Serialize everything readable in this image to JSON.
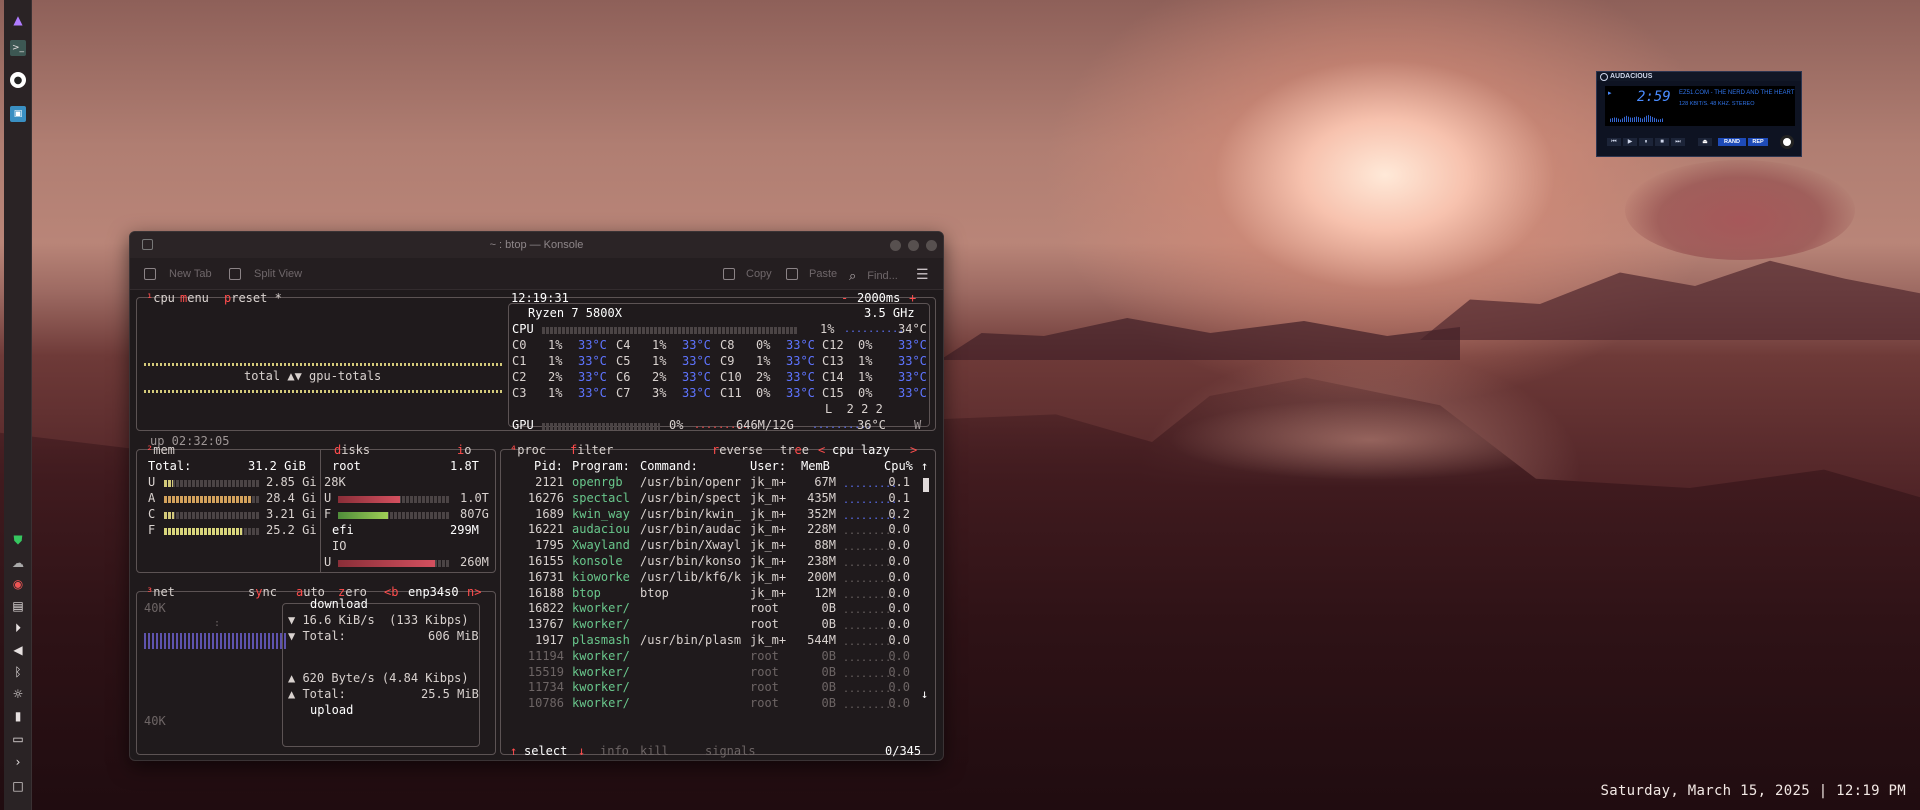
{
  "desktop": {
    "clock": "Saturday, March 15, 2025 | 12:19 PM"
  },
  "audacious": {
    "title": "AUDACIOUS",
    "time": "2:59",
    "track": "EZ51.COM - THE NERD AND THE HEART",
    "info": "128 KBIT/S. 48 KHZ. STEREO",
    "shuffle_label": "RAND",
    "repeat_label": "REP",
    "controls": [
      "prev",
      "play",
      "pause",
      "stop",
      "next"
    ]
  },
  "konsole": {
    "title": "~ : btop — Konsole",
    "toolbar": {
      "new_tab": "New Tab",
      "split_view": "Split View",
      "copy": "Copy",
      "paste": "Paste",
      "find": "Find..."
    }
  },
  "btop": {
    "cpu_header": {
      "cpu": "cpu",
      "menu": "menu",
      "preset": "preset *",
      "clock": "12:19:31",
      "interval": "2000ms",
      "minus": "-",
      "plus": "+"
    },
    "graph_label": "total ▲▼ gpu-totals",
    "uptime": "up 02:32:05",
    "cpu_model": "Ryzen 7 5800X",
    "cpu_freq": "3.5 GHz",
    "cpu_total": {
      "label": "CPU",
      "pct": "1%",
      "temp": "34°C",
      "usage": 0.01
    },
    "cores": [
      [
        "C0",
        "1%",
        "33°C",
        "C4",
        "1%",
        "33°C",
        "C8",
        "0%",
        "33°C",
        "C12",
        "0%",
        "33°C"
      ],
      [
        "C1",
        "1%",
        "33°C",
        "C5",
        "1%",
        "33°C",
        "C9",
        "1%",
        "33°C",
        "C13",
        "1%",
        "33°C"
      ],
      [
        "C2",
        "2%",
        "33°C",
        "C6",
        "2%",
        "33°C",
        "C10",
        "2%",
        "33°C",
        "C14",
        "1%",
        "33°C"
      ],
      [
        "C3",
        "1%",
        "33°C",
        "C7",
        "3%",
        "33°C",
        "C11",
        "0%",
        "33°C",
        "C15",
        "0%",
        "33°C"
      ]
    ],
    "load": "L  2 2 2",
    "gpu": {
      "label": "GPU",
      "pct": "0%",
      "mem": "646M/12G",
      "temp": "36°C",
      "w": "W",
      "usage": 0.0
    },
    "mem": {
      "title": "mem",
      "total_label": "Total:",
      "total": "31.2 GiB",
      "rows": [
        {
          "key": "U",
          "value": "2.85 Gi",
          "fraction": 0.09,
          "color": "#d3c97a"
        },
        {
          "key": "A",
          "value": "28.4 Gi",
          "fraction": 0.91,
          "color": "#d3a25c"
        },
        {
          "key": "C",
          "value": "3.21 Gi",
          "fraction": 0.1,
          "color": "#d3c97a"
        },
        {
          "key": "F",
          "value": "25.2 Gi",
          "fraction": 0.81,
          "color": "#d9d67c"
        }
      ]
    },
    "disks": {
      "title": "disks",
      "io": "io",
      "root": {
        "name": "root",
        "size": "1.8T",
        "io": "28K",
        "used_label": "U",
        "used": "1.0T",
        "used_frac": 0.55,
        "free_label": "F",
        "free": "807G",
        "free_frac": 0.45
      },
      "efi": {
        "name": "efi",
        "size": "299M",
        "io": "IO",
        "used_label": "U",
        "used": "260M",
        "used_frac": 0.87
      }
    },
    "net": {
      "title": "net",
      "sync": "sync",
      "auto": "auto",
      "zero": "zero",
      "iface_prev": "<b",
      "iface": "enp34s0",
      "iface_next": "n>",
      "scale_top": "40K",
      "scale_bottom": "40K",
      "download": "download",
      "dl_rate": "16.6 KiB/s  (133 Kibps)",
      "dl_total_label": "Total:",
      "dl_total": "606 MiB",
      "ul_rate": "620 Byte/s (4.84 Kibps)",
      "ul_total_label": "Total:",
      "ul_total": "25.5 MiB",
      "upload": "upload"
    },
    "proc": {
      "title": "proc",
      "filter": "filter",
      "reverse": "reverse",
      "tree": "tree",
      "sort": "cpu lazy",
      "headers": {
        "pid": "Pid:",
        "program": "Program:",
        "command": "Command:",
        "user": "User:",
        "mem": "MemB",
        "cpu": "Cpu%"
      },
      "rows": [
        {
          "pid": "2121",
          "program": "openrgb",
          "command": "/usr/bin/openr",
          "user": "jk_m+",
          "mem": "67M",
          "cpu": "0.1"
        },
        {
          "pid": "16276",
          "program": "spectacl",
          "command": "/usr/bin/spect",
          "user": "jk_m+",
          "mem": "435M",
          "cpu": "0.1"
        },
        {
          "pid": "1689",
          "program": "kwin_way",
          "command": "/usr/bin/kwin_",
          "user": "jk_m+",
          "mem": "352M",
          "cpu": "0.2"
        },
        {
          "pid": "16221",
          "program": "audaciou",
          "command": "/usr/bin/audac",
          "user": "jk_m+",
          "mem": "228M",
          "cpu": "0.0"
        },
        {
          "pid": "1795",
          "program": "Xwayland",
          "command": "/usr/bin/Xwayl",
          "user": "jk_m+",
          "mem": "88M",
          "cpu": "0.0"
        },
        {
          "pid": "16155",
          "program": "konsole",
          "command": "/usr/bin/konso",
          "user": "jk_m+",
          "mem": "238M",
          "cpu": "0.0"
        },
        {
          "pid": "16731",
          "program": "kioworke",
          "command": "/usr/lib/kf6/k",
          "user": "jk_m+",
          "mem": "200M",
          "cpu": "0.0"
        },
        {
          "pid": "16188",
          "program": "btop",
          "command": "btop",
          "user": "jk_m+",
          "mem": "12M",
          "cpu": "0.0"
        },
        {
          "pid": "16822",
          "program": "kworker/",
          "command": "",
          "user": "root",
          "mem": "0B",
          "cpu": "0.0"
        },
        {
          "pid": "13767",
          "program": "kworker/",
          "command": "",
          "user": "root",
          "mem": "0B",
          "cpu": "0.0"
        },
        {
          "pid": "1917",
          "program": "plasmash",
          "command": "/usr/bin/plasm",
          "user": "jk_m+",
          "mem": "544M",
          "cpu": "0.0"
        },
        {
          "pid": "11194",
          "program": "kworker/",
          "command": "",
          "user": "root",
          "mem": "0B",
          "cpu": "0.0"
        },
        {
          "pid": "15519",
          "program": "kworker/",
          "command": "",
          "user": "root",
          "mem": "0B",
          "cpu": "0.0"
        },
        {
          "pid": "11734",
          "program": "kworker/",
          "command": "",
          "user": "root",
          "mem": "0B",
          "cpu": "0.0"
        },
        {
          "pid": "10786",
          "program": "kworker/",
          "command": "",
          "user": "root",
          "mem": "0B",
          "cpu": "0.0"
        }
      ],
      "footer": {
        "select": "select",
        "info": "info",
        "kill": "kill",
        "signals": "signals",
        "count": "0/345"
      }
    }
  }
}
